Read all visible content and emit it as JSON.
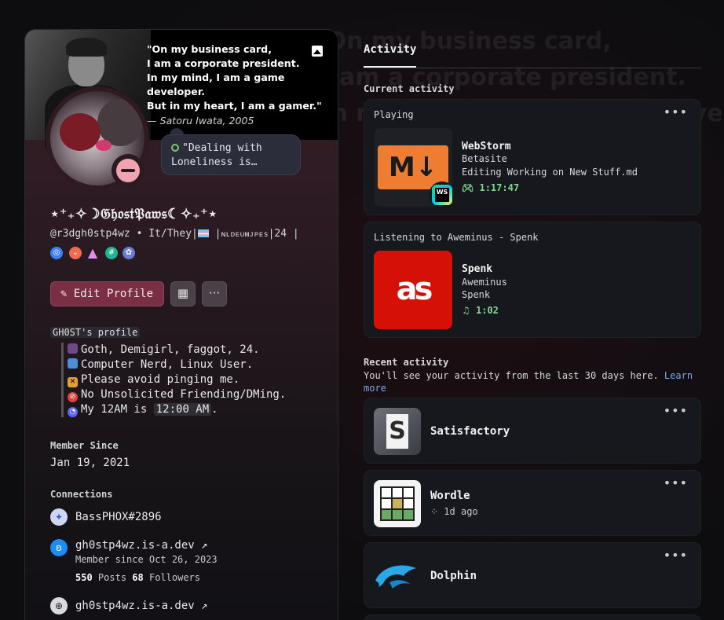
{
  "background_quote": "\"On my business card,\n I am a corporate president.\n In my mind, I am a game developer.",
  "profile": {
    "banner_quote": [
      "\"On my business card,",
      "I am a corporate president.",
      "In my mind, I am a game developer.",
      "But in my heart, I am a gamer.\""
    ],
    "banner_attribution": "— Satoru Iwata, 2005",
    "status_bubble": "\"Dealing with Loneliness is…",
    "display_name": "⋆⁺₊✧☽𝔊𝔥𝔬𝔰𝔱𝔓𝔞𝔴𝔰☾✧₊⁺⋆",
    "handle": "@r3dgh0stp4wz",
    "pronouns": "It/They",
    "tag_text": "ɴʟᴅᴇᴜᴍᴊᴘᴇs",
    "age": "24",
    "edit_button": "Edit Profile",
    "bio_title": "GH0ST's profile",
    "bio_items": [
      "Goth, Demigirl, faggot, 24.",
      "Computer Nerd, Linux User.",
      "Please avoid pinging me.",
      "No Unsolicited Friending/DMing."
    ],
    "bio_time_prefix": "My 12AM is",
    "bio_time_value": "12:00 AM",
    "bio_time_suffix": ".",
    "member_since_label": "Member Since",
    "member_since_value": "Jan 19, 2021",
    "connections_label": "Connections",
    "connections": [
      {
        "name": "BassPHOX#2896"
      },
      {
        "name": "gh0stp4wz.is-a.dev ↗",
        "sub": "Member since Oct 26, 2023",
        "posts": "550",
        "posts_label": "Posts",
        "followers": "68",
        "followers_label": "Followers"
      },
      {
        "name": "gh0stp4wz.is-a.dev ↗"
      }
    ]
  },
  "activity": {
    "tab": "Activity",
    "current_label": "Current activity",
    "playing": {
      "header": "Playing",
      "title": "WebStorm",
      "line1": "Betasite",
      "line2": "Editing Working on New Stuff.md",
      "time": "1:17:47",
      "art_text": "M↓",
      "badge": "WS"
    },
    "listening": {
      "header": "Listening to Aweminus - Spenk",
      "title": "Spenk",
      "line1": "Aweminus",
      "line2": "Spenk",
      "time": "1:02"
    },
    "recent_label": "Recent activity",
    "recent_text": "You'll see your activity from the last 30 days here.",
    "recent_link": "Learn more",
    "recent": [
      {
        "title": "Satisfactory",
        "sub": ""
      },
      {
        "title": "Wordle",
        "sub": "1d ago"
      },
      {
        "title": "Dolphin",
        "sub": ""
      }
    ],
    "more_icon": "•••"
  },
  "colors": {
    "accent_button": "#7a2f45",
    "status_dnd": "#f0a3b0",
    "elapsed_green": "#7fd98b",
    "link_blue": "#7da4f0"
  }
}
